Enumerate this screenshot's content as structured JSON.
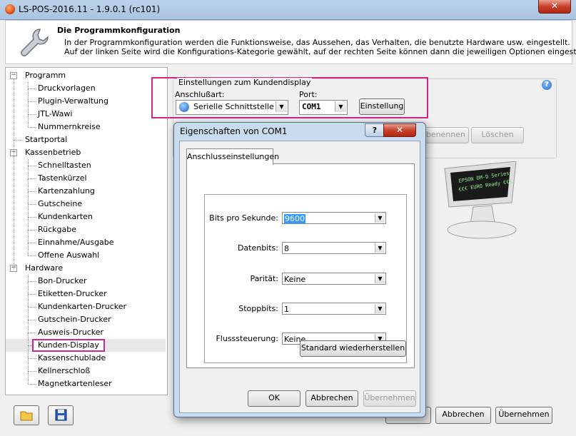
{
  "window": {
    "title": "LS-POS-2016.11 - 1.9.0.1 (rc101)",
    "close": "✕"
  },
  "header": {
    "title": "Die Programmkonfiguration",
    "line1": "In der Programmkonfiguration werden die Funktionsweise, das Aussehen, das Verhalten, die benutzte Hardware usw. eingestellt.",
    "line2": "Auf der linken Seite wird die Konfigurations-Kategorie gewählt, auf der rechten Seite können dann die jeweiligen Optionen eingestellt werden."
  },
  "tree": {
    "groups": [
      {
        "label": "Programm",
        "children": [
          "Druckvorlagen",
          "Plugin-Verwaltung",
          "JTL-Wawi",
          "Nummernkreise"
        ]
      },
      {
        "label": "Startportal",
        "children": []
      },
      {
        "label": "Kassenbetrieb",
        "children": [
          "Schnelltasten",
          "Tastenkürzel",
          "Kartenzahlung",
          "Gutscheine",
          "Kundenkarten",
          "Rückgabe",
          "Einnahme/Ausgabe",
          "Offene Auswahl"
        ]
      },
      {
        "label": "Hardware",
        "children": [
          "Bon-Drucker",
          "Etiketten-Drucker",
          "Kundenkarten-Drucker",
          "Gutschein-Drucker",
          "Ausweis-Drucker",
          "Kunden-Display",
          "Kassenschublade",
          "Kellnerschloß",
          "Magnetkartenleser"
        ]
      }
    ],
    "selected": "Kunden-Display"
  },
  "display_settings": {
    "group_title": "Einstellungen zum Kundendisplay",
    "connection_label": "Anschlußart:",
    "connection_value": "Serielle Schnittstelle",
    "port_label": "Port:",
    "port_value": "COM1",
    "settings_button": "Einstellung",
    "rename_button": "benennen",
    "delete_button": "Löschen",
    "help": "?"
  },
  "footer": {
    "ok": "OK",
    "cancel": "Abbrechen",
    "apply": "Übernehmen"
  },
  "dialog": {
    "title": "Eigenschaften von COM1",
    "help": "?",
    "close": "✕",
    "tab": "Anschlusseinstellungen",
    "fields": [
      {
        "label": "Bits pro Sekunde:",
        "value": "9600"
      },
      {
        "label": "Datenbits:",
        "value": "8"
      },
      {
        "label": "Parität:",
        "value": "Keine"
      },
      {
        "label": "Stoppbits:",
        "value": "1"
      },
      {
        "label": "Flusssteuerung:",
        "value": "Keine"
      }
    ],
    "restore_button": "Standard wiederherstellen",
    "ok": "OK",
    "cancel": "Abbrechen",
    "apply": "Übernehmen"
  },
  "lcd_text": {
    "line1": "EPSON DM-D Series",
    "line2": "€€€ EURO Ready €€€"
  }
}
